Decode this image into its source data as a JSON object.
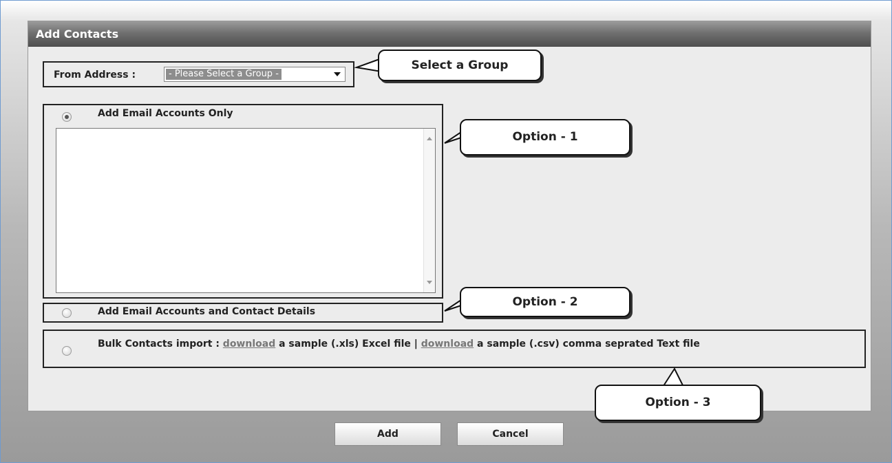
{
  "panel": {
    "title": "Add Contacts"
  },
  "from": {
    "label": "From Address :",
    "selected": "- Please Select a Group -"
  },
  "options": [
    {
      "label": "Add Email Accounts Only",
      "checked": true
    },
    {
      "label": "Add Email Accounts and Contact Details",
      "checked": false
    },
    {
      "checked": false,
      "prefix": "Bulk Contacts import :",
      "link1": "download",
      "middle": "a sample (.xls) Excel file |",
      "link2": "download",
      "suffix": "a sample (.csv) comma seprated Text file"
    }
  ],
  "callouts": {
    "group": "Select a Group",
    "option1": "Option - 1",
    "option2": "Option - 2",
    "option3": "Option - 3"
  },
  "buttons": {
    "add": "Add",
    "cancel": "Cancel"
  },
  "icons": {
    "dropdown": "chevron-down-icon",
    "scroll_up": "scroll-up-arrow-icon",
    "scroll_down": "scroll-down-arrow-icon"
  }
}
